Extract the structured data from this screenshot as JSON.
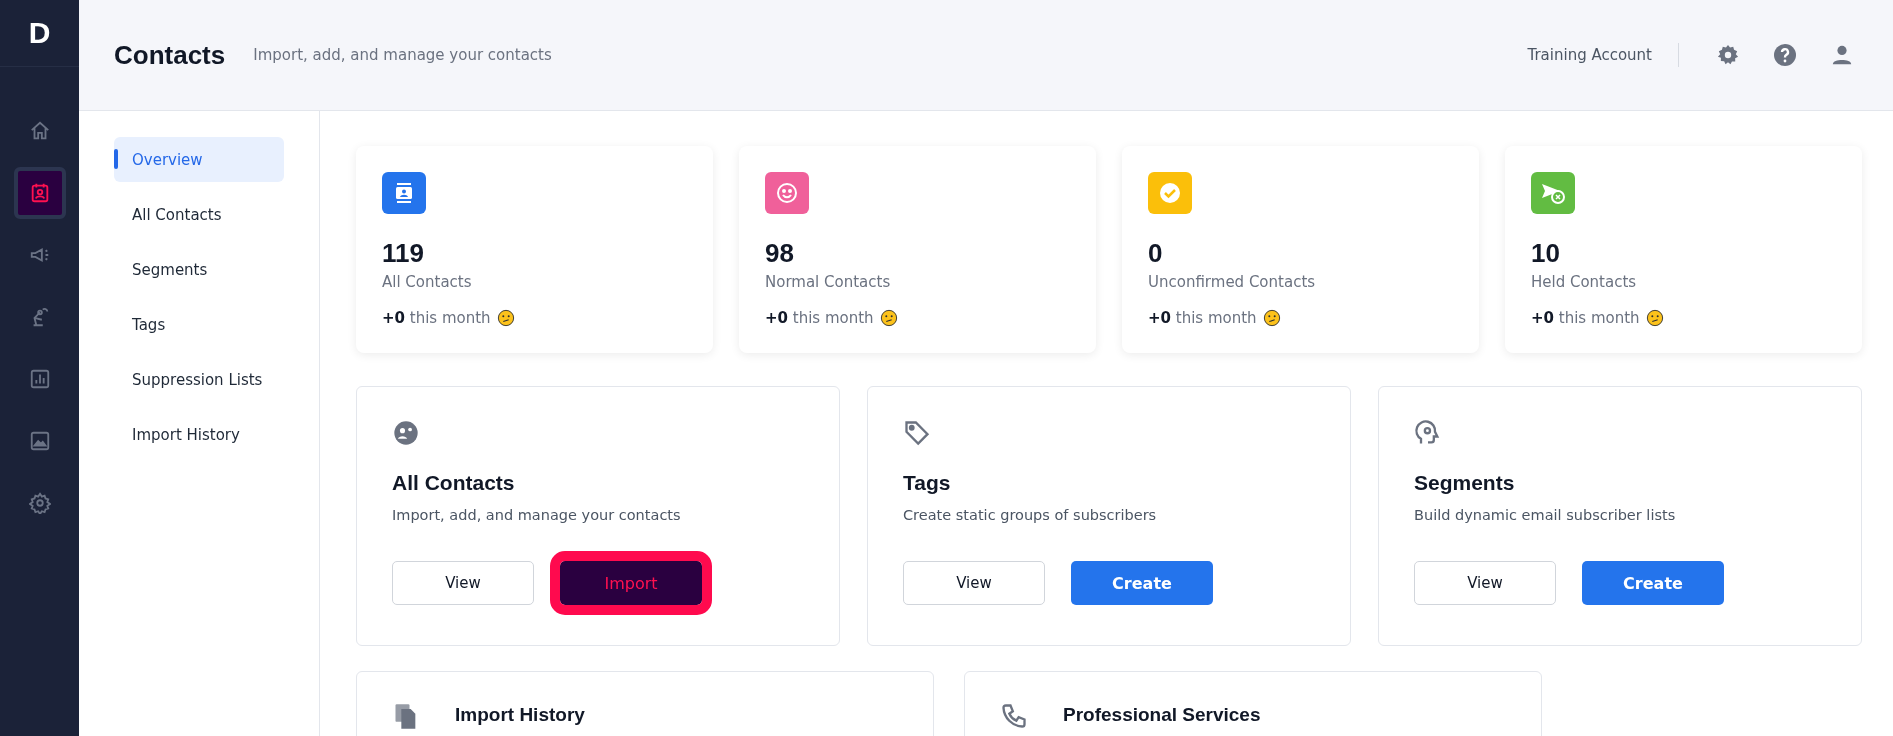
{
  "rail": {
    "logo": "D",
    "items": [
      {
        "selected": false
      },
      {
        "selected": true
      },
      {
        "selected": false
      },
      {
        "selected": false
      },
      {
        "selected": false
      },
      {
        "selected": false
      },
      {
        "selected": false
      }
    ]
  },
  "header": {
    "title": "Contacts",
    "subtitle": "Import, add, and manage your contacts",
    "account": "Training Account"
  },
  "subnav": {
    "items": [
      {
        "label": "Overview",
        "selected": true
      },
      {
        "label": "All Contacts",
        "selected": false
      },
      {
        "label": "Segments",
        "selected": false
      },
      {
        "label": "Tags",
        "selected": false
      },
      {
        "label": "Suppression Lists",
        "selected": false
      },
      {
        "label": "Import History",
        "selected": false
      }
    ]
  },
  "stats": [
    {
      "value": "119",
      "label": "All Contacts",
      "change": "**+0** this month",
      "color": "#2474ec"
    },
    {
      "value": "98",
      "label": "Normal Contacts",
      "change": "**+0** this month",
      "color": "#f0609a"
    },
    {
      "value": "0",
      "label": "Unconfirmed Contacts",
      "change": "**+0** this month",
      "color": "#fbbf0a"
    },
    {
      "value": "10",
      "label": "Held Contacts",
      "change": "**+0** this month",
      "color": "#62bc42"
    }
  ],
  "features": [
    {
      "title": "All Contacts",
      "description": "Import, add, and manage your contacts",
      "buttons": [
        {
          "label": "View",
          "kind": "outline",
          "highlighted": false
        },
        {
          "label": "Import",
          "kind": "dark",
          "highlighted": true
        }
      ]
    },
    {
      "title": "Tags",
      "description": "Create static groups of subscribers",
      "buttons": [
        {
          "label": "View",
          "kind": "outline",
          "highlighted": false
        },
        {
          "label": "Create",
          "kind": "primary",
          "highlighted": false
        }
      ]
    },
    {
      "title": "Segments",
      "description": "Build dynamic email subscriber lists",
      "buttons": [
        {
          "label": "View",
          "kind": "outline",
          "highlighted": false
        },
        {
          "label": "Create",
          "kind": "primary",
          "highlighted": false
        }
      ]
    }
  ],
  "more": [
    {
      "title": "Import History"
    },
    {
      "title": "Professional Services"
    }
  ]
}
